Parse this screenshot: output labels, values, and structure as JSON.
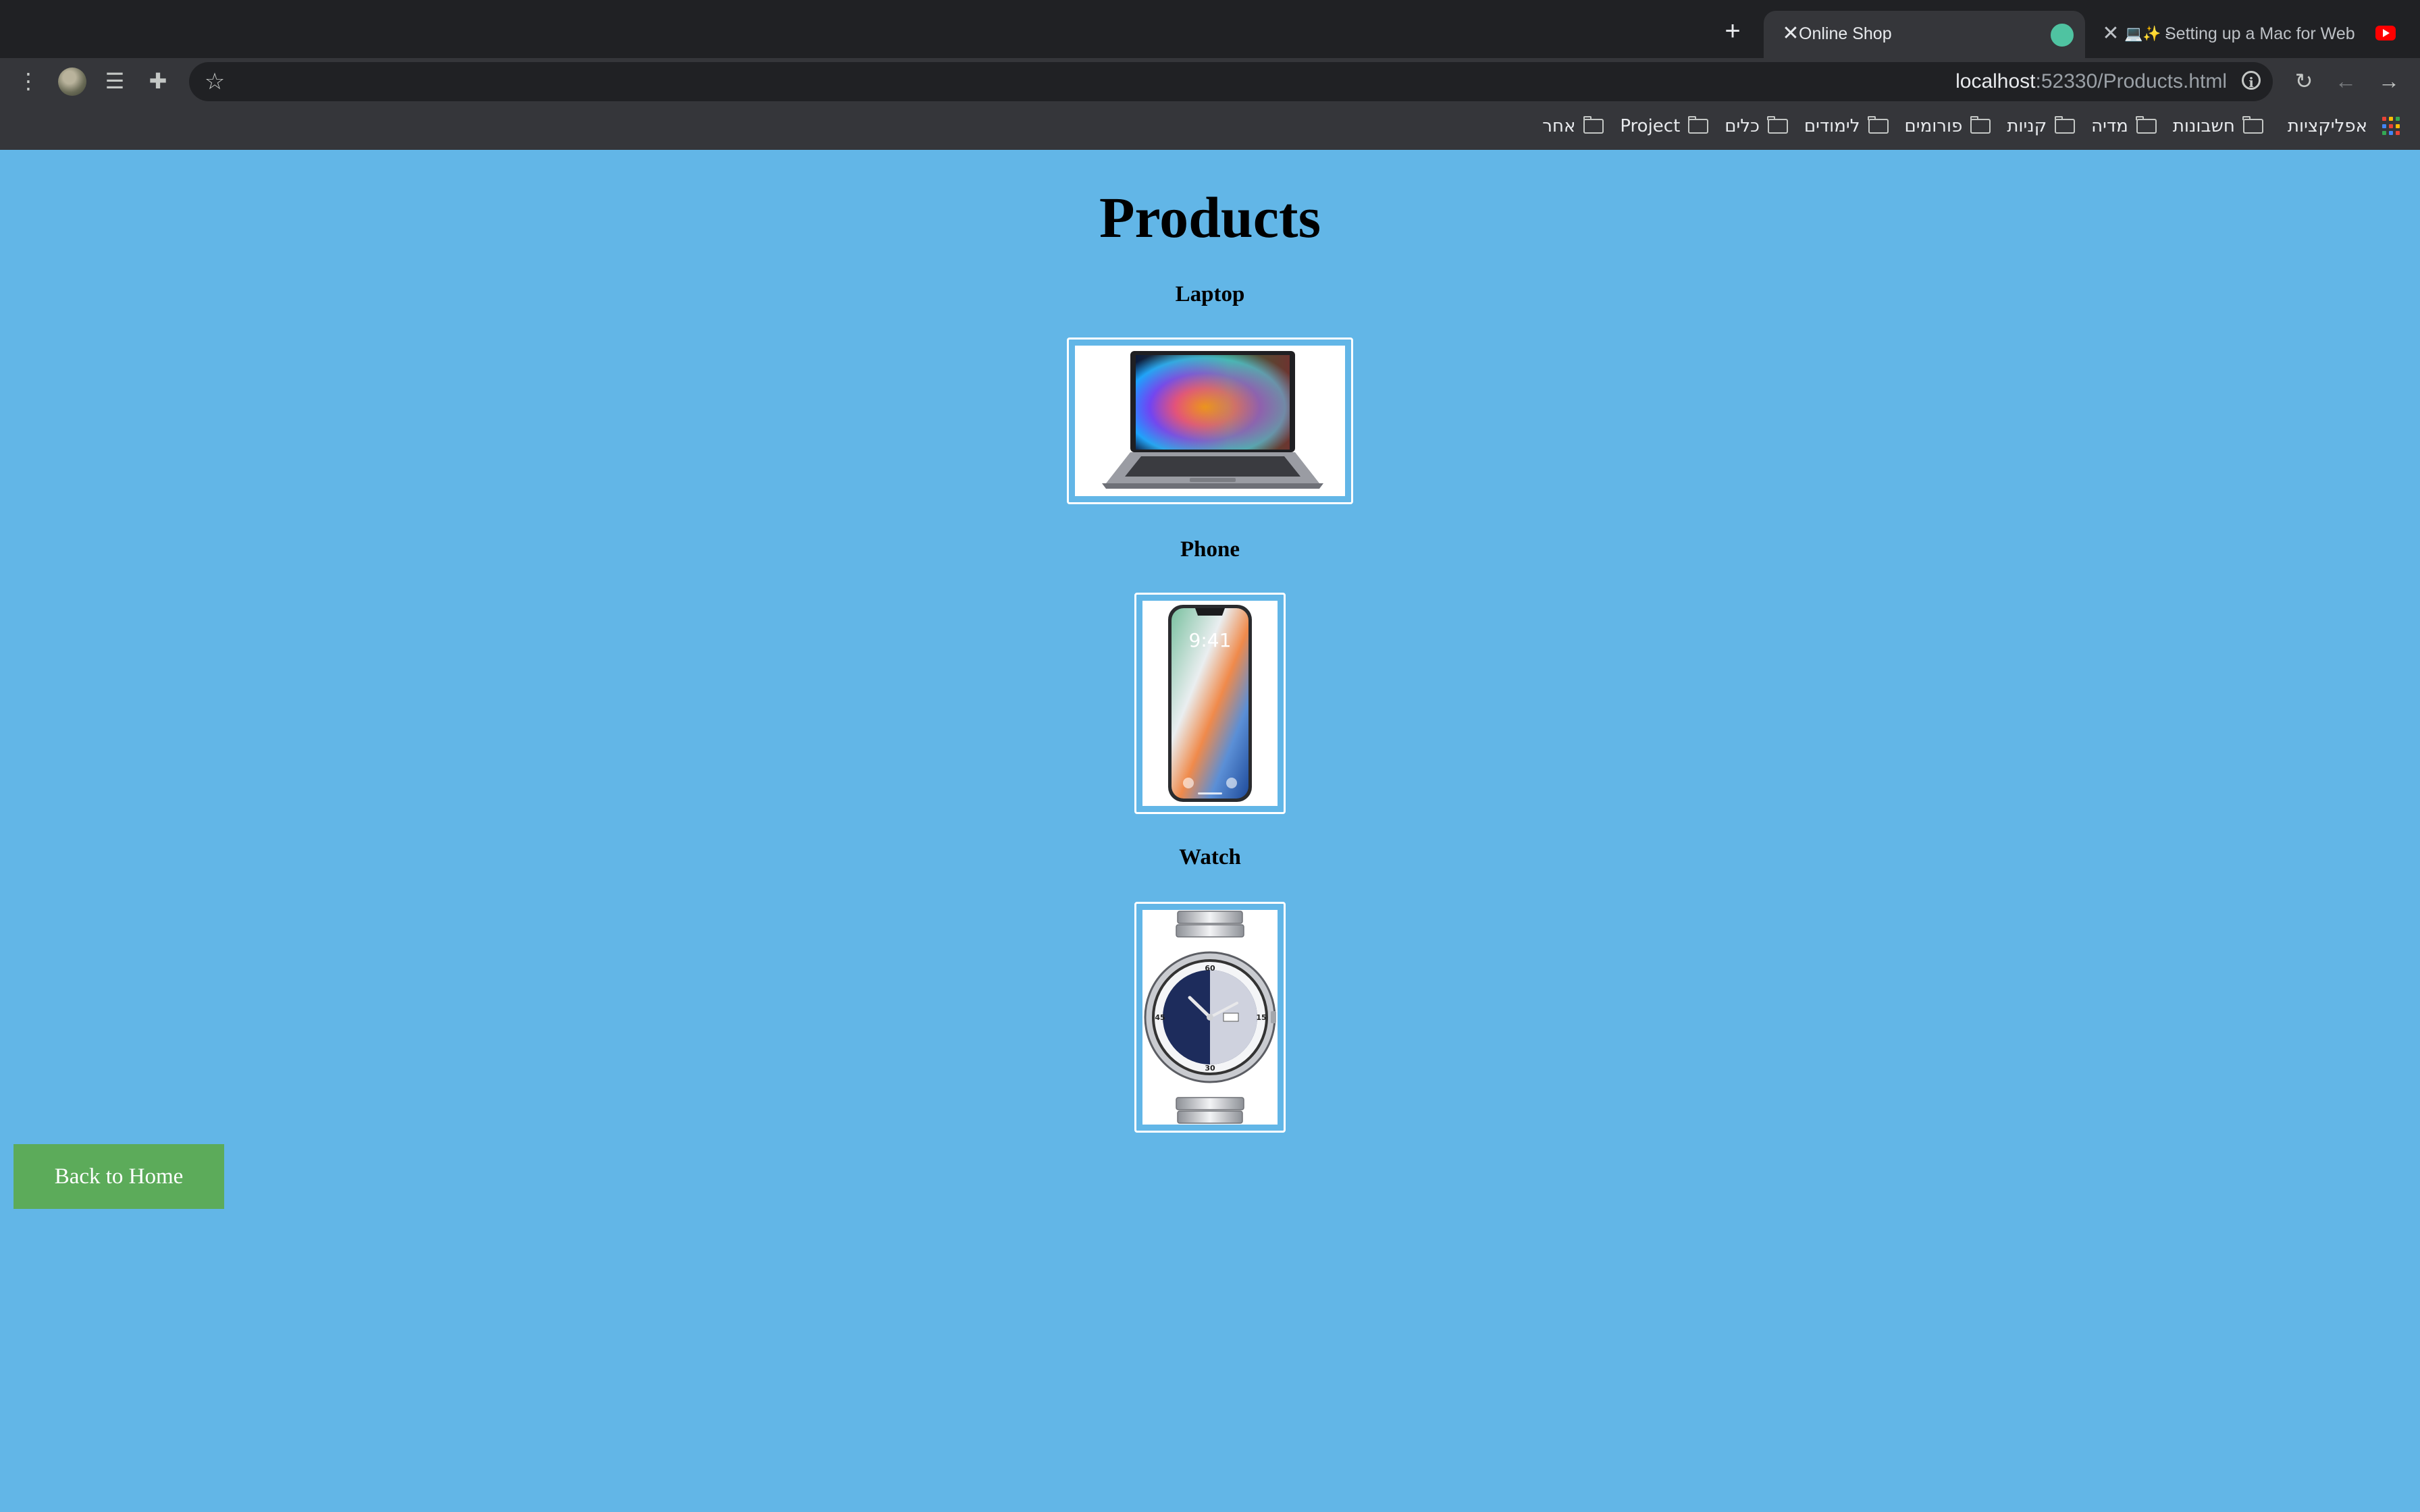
{
  "browser": {
    "tabs": [
      {
        "title": "Online Shop",
        "active": true
      },
      {
        "title": "Setting up a Mac for Web",
        "emoji": "💻✨ -",
        "active": false
      }
    ],
    "url": {
      "host": "localhost",
      "rest": ":52330/Products.html"
    },
    "bookmarks": {
      "apps_label": "אפליקציות",
      "folders": [
        "חשבונות",
        "מדיה",
        "קניות",
        "פורומים",
        "לימודים",
        "כלים",
        "Project",
        "אחר"
      ]
    }
  },
  "page": {
    "title": "Products",
    "products": [
      {
        "name": "Laptop",
        "image": "laptop-image"
      },
      {
        "name": "Phone",
        "image": "phone-image"
      },
      {
        "name": "Watch",
        "image": "watch-image"
      }
    ],
    "phone_clock": "9:41",
    "watch_numerals": {
      "top": "60",
      "bottom": "30",
      "left": "45",
      "right": "15"
    },
    "back_button": "Back to Home"
  },
  "colors": {
    "page_background": "#62b6e7",
    "button_background": "#5cab5a",
    "frame_border": "#ffffff"
  }
}
